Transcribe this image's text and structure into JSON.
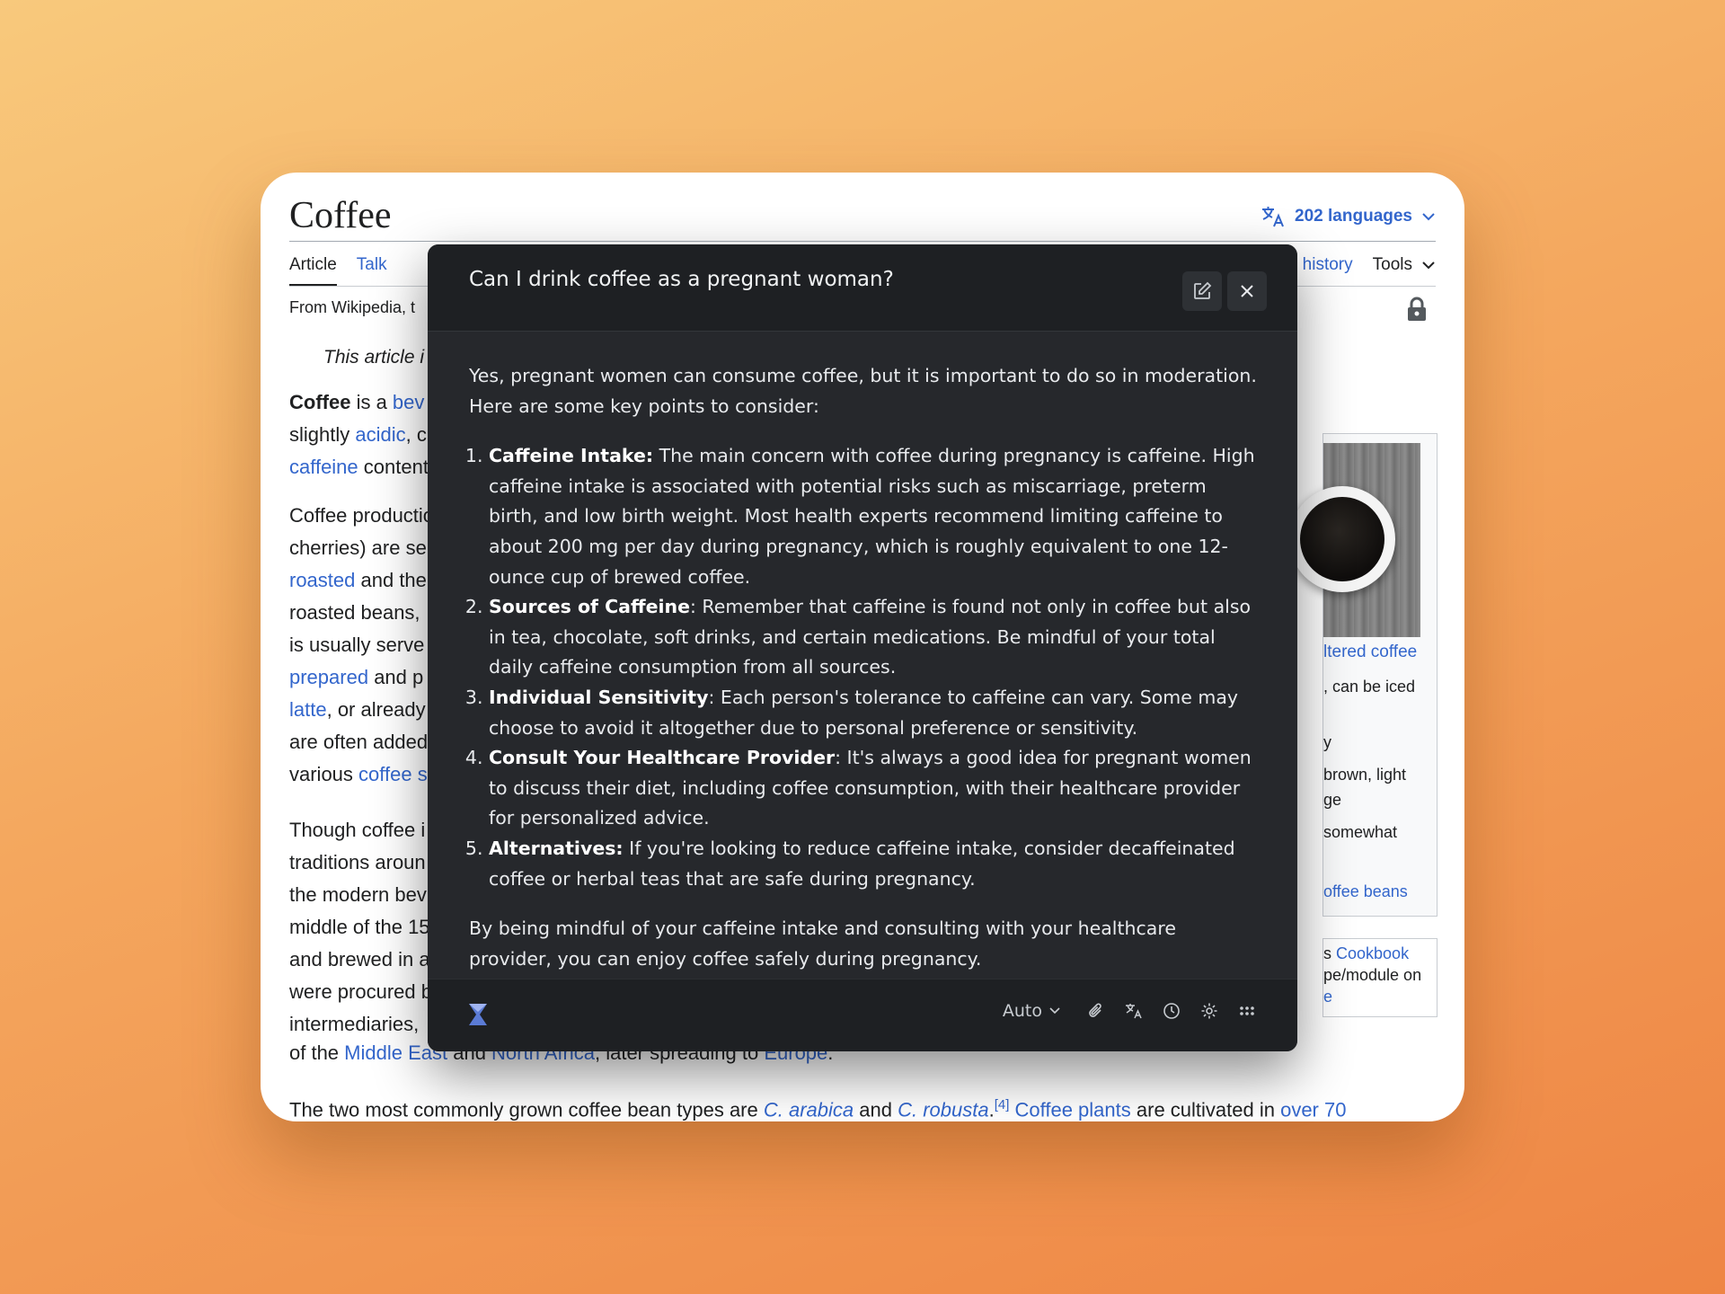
{
  "wiki": {
    "title": "Coffee",
    "languages": "202 languages",
    "tabs": {
      "article": "Article",
      "talk": "Talk"
    },
    "right_tabs": {
      "history": "history",
      "tools": "Tools"
    },
    "from": "From Wikipedia, t",
    "hatnote": "This article i",
    "para1": {
      "bold": "Coffee",
      "t1": " is a ",
      "l1": "bev",
      "t2": "slightly ",
      "l2": "acidic",
      "t3": ", c",
      "l3": "caffeine",
      "t4": " content"
    },
    "para2": {
      "lines": [
        "Coffee productio",
        "cherries) are se"
      ],
      "l_roasted": "roasted",
      "t_roasted": " and the",
      "line4": "roasted beans,",
      "line5": "is usually serve",
      "l_prepared": "prepared",
      "t_prepared": " and p",
      "l_latte": "latte",
      "t_latte": ", or already",
      "line8": "are often added",
      "t_various": "various ",
      "l_coffee_s": "coffee s"
    },
    "para3": {
      "lines": [
        "Though coffee i",
        "traditions aroun",
        "the modern bev",
        "middle of the 15",
        "and brewed in a",
        "were procured b",
        "intermediaries, "
      ]
    },
    "line_mideast": {
      "t1": "of the ",
      "l1": "Middle East",
      "t2": " and ",
      "l2": "North Africa",
      "t3": ", later spreading to ",
      "l3": "Europe",
      "t4": "."
    },
    "para4": {
      "t1": "The two most commonly grown coffee bean types are ",
      "l1": "C. arabica",
      "t2": " and ",
      "l2": "C. robusta",
      "t3": ".",
      "sup": "[4]",
      "t4": " ",
      "l3": "Coffee plants",
      "t5": " are cultivated in ",
      "l4": "over 70"
    },
    "infobox": {
      "caption": "ltered coffee",
      "r1": ", can be iced",
      "r2": "y",
      "r3": " brown, light",
      "r4": "ge",
      "r5": " somewhat",
      "r6": "offee beans"
    },
    "cookbook": {
      "l1_t": "s ",
      "l1_link": "Cookbook",
      "l2": "pe/module on",
      "l3": "e"
    }
  },
  "dialog": {
    "question": "Can I drink coffee as a pregnant woman?",
    "intro": "Yes, pregnant women can consume coffee, but it is important to do so in moderation. Here are some key points to consider:",
    "points": [
      {
        "title": "Caffeine Intake:",
        "text": " The main concern with coffee during pregnancy is caffeine. High caffeine intake is associated with potential risks such as miscarriage, preterm birth, and low birth weight. Most health experts recommend limiting caffeine to about 200 mg per day during pregnancy, which is roughly equivalent to one 12-ounce cup of brewed coffee."
      },
      {
        "title": "Sources of Caffeine",
        "text": ": Remember that caffeine is found not only in coffee but also in tea, chocolate, soft drinks, and certain medications. Be mindful of your total daily caffeine consumption from all sources."
      },
      {
        "title": "Individual Sensitivity",
        "text": ": Each person's tolerance to caffeine can vary. Some may choose to avoid it altogether due to personal preference or sensitivity."
      },
      {
        "title": "Consult Your Healthcare Provider",
        "text": ": It's always a good idea for pregnant women to discuss their diet, including coffee consumption, with their healthcare provider for personalized advice."
      },
      {
        "title": "Alternatives:",
        "text": " If you're looking to reduce caffeine intake, consider decaffeinated coffee or herbal teas that are safe during pregnancy."
      }
    ],
    "conclusion": "By being mindful of your caffeine intake and consulting with your healthcare provider, you can enjoy coffee safely during pregnancy.",
    "footer": {
      "model": "Auto"
    }
  },
  "icons": {
    "translate": "translate-icon",
    "chevron": "chevron-down-icon",
    "lock": "lock-icon",
    "edit": "edit-icon",
    "close": "close-icon",
    "logo": "hourglass-logo-icon",
    "attach": "paperclip-icon",
    "lang": "translate-icon",
    "history": "clock-icon",
    "settings": "gear-icon",
    "apps": "grid-dots-icon"
  },
  "colors": {
    "link": "#3366cc",
    "dialog_bg": "#26282c",
    "background": "#f4a75e"
  }
}
